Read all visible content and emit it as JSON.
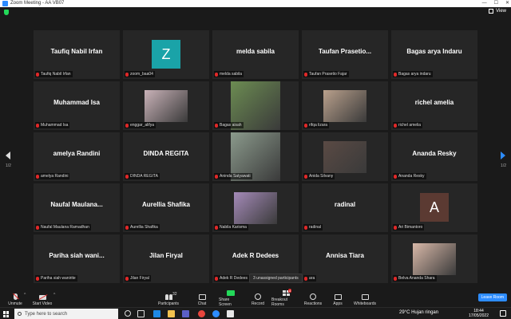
{
  "window": {
    "title": "Zoom Meeting - AA VB07",
    "controls": [
      "—",
      "☐",
      "✕"
    ],
    "view_label": "View"
  },
  "tiles": [
    {
      "display": "Taufiq Nabil Irfan",
      "tag": "Taufiq Nabil Irfan",
      "kind": "name"
    },
    {
      "display": "Z",
      "tag": "zoom_baa04",
      "kind": "avatar",
      "color": "#1aa3a8"
    },
    {
      "display": "melda sabila",
      "tag": "melda sabila",
      "kind": "name"
    },
    {
      "display": "Taufan  Prasetio...",
      "tag": "Taufan Prasetio Fajar",
      "kind": "name"
    },
    {
      "display": "Bagas arya Indaru",
      "tag": "Bagas arya indaru",
      "kind": "name"
    },
    {
      "display": "Muhammad Isa",
      "tag": "Muhammad Isa",
      "kind": "name"
    },
    {
      "display": "",
      "tag": "enggar_alifya",
      "kind": "video",
      "color": "#c9b2b8"
    },
    {
      "display": "",
      "tag": "Bagas aisah",
      "kind": "video",
      "color": "#6c8c52"
    },
    {
      "display": "",
      "tag": "rifqa lizara",
      "kind": "video",
      "color": "#b9a08c"
    },
    {
      "display": "richel amelia",
      "tag": "richel amelia",
      "kind": "name"
    },
    {
      "display": "amelya Randini",
      "tag": "amelya Randini",
      "kind": "name"
    },
    {
      "display": "DINDA REGITA",
      "tag": "DINDA REGITA",
      "kind": "name"
    },
    {
      "display": "",
      "tag": "Aninda Satyawati",
      "kind": "video",
      "color": "#8b9a8c"
    },
    {
      "display": "",
      "tag": "Anida Silvany",
      "kind": "video",
      "color": "#5a4a44"
    },
    {
      "display": "Ananda Resky",
      "tag": "Ananda Resky",
      "kind": "name"
    },
    {
      "display": "Naufal  Maulana...",
      "tag": "Naufal Maulana Ramadhan",
      "kind": "name"
    },
    {
      "display": "Aurellia Shafika",
      "tag": "Aurellia Shafika",
      "kind": "name"
    },
    {
      "display": "",
      "tag": "Nabila Karisma",
      "kind": "video",
      "color": "#a48ab8"
    },
    {
      "display": "radinal",
      "tag": "radinal",
      "kind": "name"
    },
    {
      "display": "A",
      "tag": "Ari Bimantoro",
      "kind": "avatar",
      "color": "#5b3a32"
    },
    {
      "display": "Pariha  siah wani...",
      "tag": "Pariha siah wanirite",
      "kind": "name"
    },
    {
      "display": "Jilan Firyal",
      "tag": "Jilan Firyal",
      "kind": "name"
    },
    {
      "display": "Adek R Dedees",
      "tag": "Adek R Dedees",
      "kind": "name"
    },
    {
      "display": "Annisa Tiara",
      "tag": "ara",
      "kind": "name"
    },
    {
      "display": "",
      "tag": "Belva Ananda Shara",
      "kind": "video",
      "color": "#d8b8a8"
    }
  ],
  "pager": {
    "left": "1/2",
    "right": "1/2"
  },
  "unassigned": "3 unassigned participants",
  "toolbar": {
    "unmute": "Unmute",
    "start_video": "Start Video",
    "participants": "Participants",
    "participants_count": "32",
    "chat": "Chat",
    "share_screen": "Share Screen",
    "record": "Record",
    "breakout_rooms": "Breakout Rooms",
    "breakout_badge": "4",
    "reactions": "Reactions",
    "apps": "Apps",
    "whiteboards": "Whiteboards",
    "leave": "Leave Room"
  },
  "taskbar": {
    "search_placeholder": "Type here to search",
    "weather": "29°C  Hujan ringan",
    "time": "18:44",
    "date": "17/05/2022"
  }
}
